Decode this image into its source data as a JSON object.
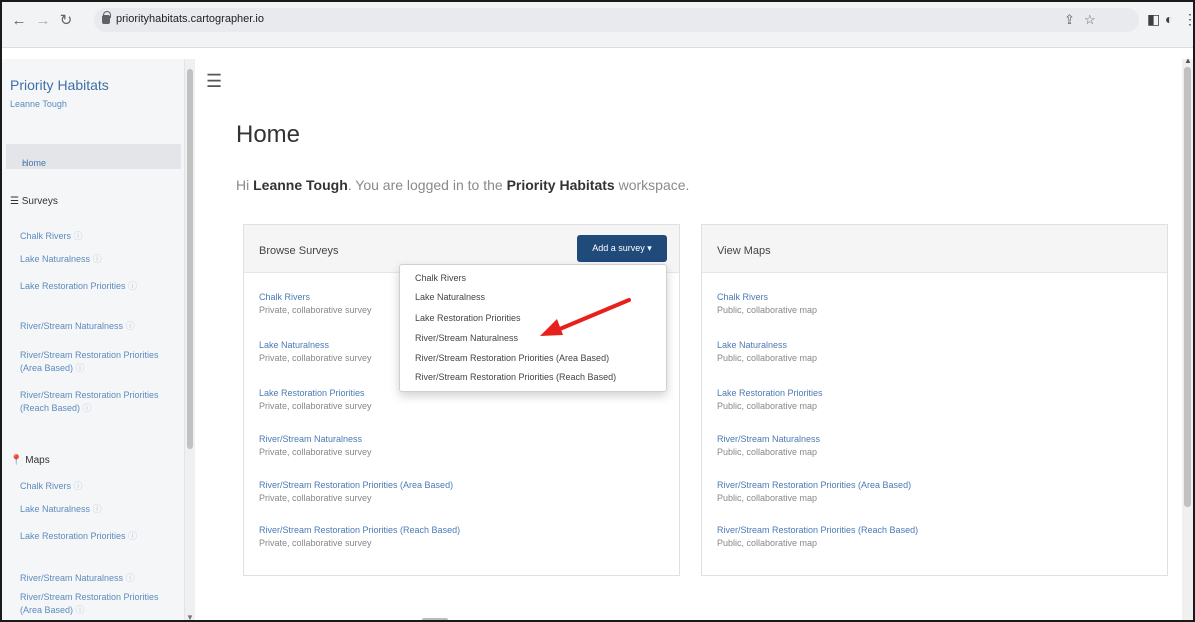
{
  "browser": {
    "url": "priorityhabitats.cartographer.io"
  },
  "sidebar": {
    "title": "Priority Habitats",
    "user": "Leanne Tough",
    "home": "Home",
    "surveys_heading": "Surveys",
    "surveys": [
      "Chalk Rivers",
      "Lake Naturalness",
      "Lake Restoration Priorities",
      "River/Stream Naturalness",
      "River/Stream Restoration Priorities (Area Based)",
      "River/Stream Restoration Priorities (Reach Based)"
    ],
    "maps_heading": "Maps",
    "maps": [
      "Chalk Rivers",
      "Lake Naturalness",
      "Lake Restoration Priorities",
      "River/Stream Naturalness",
      "River/Stream Restoration Priorities (Area Based)"
    ]
  },
  "main": {
    "title": "Home",
    "greeting_prefix": "Hi ",
    "greeting_user": "Leanne Tough",
    "greeting_mid": ". You are logged in to the ",
    "greeting_workspace": "Priority Habitats",
    "greeting_suffix": " workspace."
  },
  "browse": {
    "title": "Browse Surveys",
    "add_label": "Add a survey ▾",
    "items": [
      {
        "name": "Chalk Rivers",
        "sub": "Private, collaborative survey"
      },
      {
        "name": "Lake Naturalness",
        "sub": "Private, collaborative survey"
      },
      {
        "name": "Lake Restoration Priorities",
        "sub": "Private, collaborative survey"
      },
      {
        "name": "River/Stream Naturalness",
        "sub": "Private, collaborative survey"
      },
      {
        "name": "River/Stream Restoration Priorities (Area Based)",
        "sub": "Private, collaborative survey"
      },
      {
        "name": "River/Stream Restoration Priorities (Reach Based)",
        "sub": "Private, collaborative survey"
      }
    ]
  },
  "maps_panel": {
    "title": "View Maps",
    "items": [
      {
        "name": "Chalk Rivers",
        "sub": "Public, collaborative map"
      },
      {
        "name": "Lake Naturalness",
        "sub": "Public, collaborative map"
      },
      {
        "name": "Lake Restoration Priorities",
        "sub": "Public, collaborative map"
      },
      {
        "name": "River/Stream Naturalness",
        "sub": "Public, collaborative map"
      },
      {
        "name": "River/Stream Restoration Priorities (Area Based)",
        "sub": "Public, collaborative map"
      },
      {
        "name": "River/Stream Restoration Priorities (Reach Based)",
        "sub": "Public, collaborative map"
      }
    ]
  },
  "dropdown": {
    "items": [
      "Chalk Rivers",
      "Lake Naturalness",
      "Lake Restoration Priorities",
      "River/Stream Naturalness",
      "River/Stream Restoration Priorities (Area Based)",
      "River/Stream Restoration Priorities (Reach Based)"
    ]
  },
  "colors": {
    "accent": "#1f4a7a",
    "link": "#4a7ab5",
    "annotation_arrow": "#e8201c"
  }
}
